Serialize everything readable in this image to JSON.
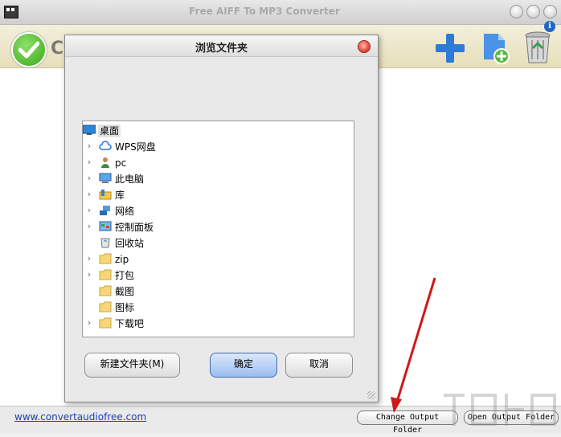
{
  "window": {
    "title": "Free AIFF To MP3 Converter",
    "toolbar_label": "C",
    "accent_color": "#1f66c8",
    "icons": [
      "film-icon",
      "check-icon",
      "add-icon",
      "add-file-icon",
      "recycle-bin-icon",
      "info-icon"
    ],
    "info_glyph": "i"
  },
  "bottom": {
    "website": "www.convertaudiofree.com",
    "change_output": "Change Output Folder",
    "open_output": "Open Output Folder"
  },
  "dialog": {
    "title": "浏览文件夹",
    "tree": [
      {
        "label": "桌面",
        "icon": "desktop-icon",
        "expandable": false,
        "selected": true
      },
      {
        "label": "WPS网盘",
        "icon": "cloud-icon",
        "expandable": true
      },
      {
        "label": "pc",
        "icon": "user-icon",
        "expandable": true
      },
      {
        "label": "此电脑",
        "icon": "computer-icon",
        "expandable": true
      },
      {
        "label": "库",
        "icon": "library-icon",
        "expandable": true
      },
      {
        "label": "网络",
        "icon": "network-icon",
        "expandable": true
      },
      {
        "label": "控制面板",
        "icon": "control-panel-icon",
        "expandable": true
      },
      {
        "label": "回收站",
        "icon": "recycle-bin-icon",
        "expandable": false
      },
      {
        "label": "zip",
        "icon": "folder-icon",
        "expandable": true
      },
      {
        "label": "打包",
        "icon": "folder-icon",
        "expandable": true
      },
      {
        "label": "截图",
        "icon": "folder-icon",
        "expandable": false
      },
      {
        "label": "图标",
        "icon": "folder-icon",
        "expandable": false
      },
      {
        "label": "下载吧",
        "icon": "folder-icon",
        "expandable": true
      }
    ],
    "new_folder": "新建文件夹(M)",
    "ok": "确定",
    "cancel": "取消"
  }
}
